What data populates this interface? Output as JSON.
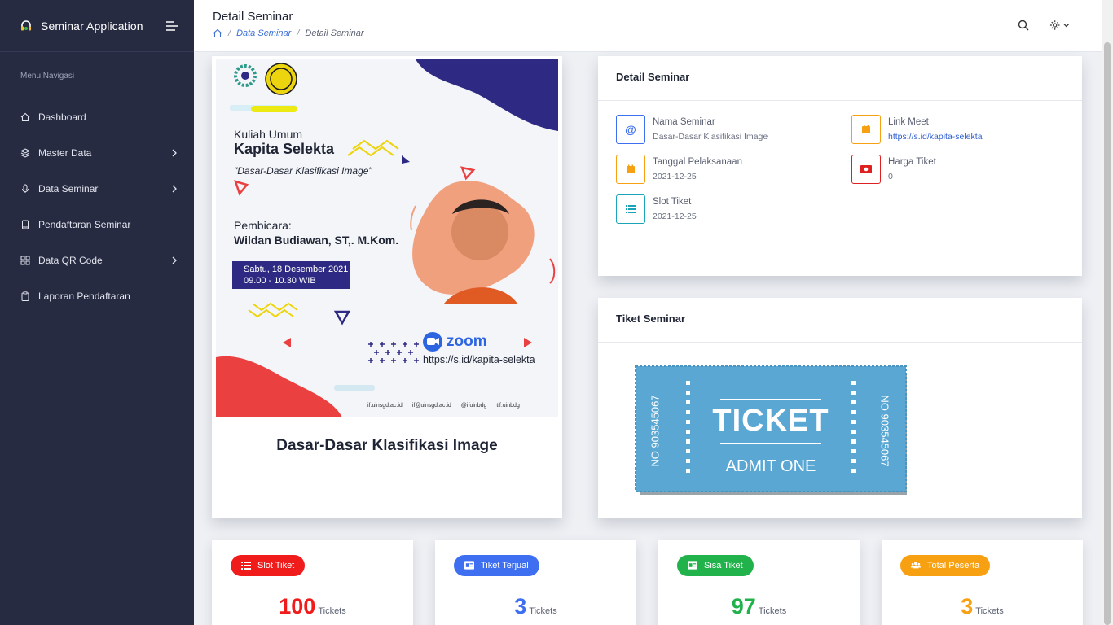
{
  "app": {
    "title": "Seminar Application"
  },
  "sidebar": {
    "heading": "Menu Navigasi",
    "items": [
      {
        "label": "Dashboard",
        "icon": "home-icon"
      },
      {
        "label": "Master Data",
        "icon": "layers-icon"
      },
      {
        "label": "Data Seminar",
        "icon": "microphone-icon"
      },
      {
        "label": "Pendaftaran Seminar",
        "icon": "book-icon"
      },
      {
        "label": "Data QR Code",
        "icon": "grid-icon"
      },
      {
        "label": "Laporan Pendaftaran",
        "icon": "clipboard-icon"
      }
    ]
  },
  "header": {
    "title": "Detail Seminar",
    "breadcrumb": {
      "link": "Data Seminar",
      "current": "Detail Seminar"
    }
  },
  "poster": {
    "subtitle": "Kuliah Umum",
    "title": "Kapita Selekta",
    "topic": "\"Dasar-Dasar Klasifikasi Image\"",
    "speaker_label": "Pembicara:",
    "speaker": "Wildan Budiawan, ST,. M.Kom.",
    "date": "Sabtu, 18 Desember 2021",
    "time": "09.00 - 10.30 WIB",
    "platform": "zoom",
    "url": "https://s.id/kapita-selekta",
    "footer": [
      "if.uinsgd.ac.id",
      "if@uinsgd.ac.id",
      "@ifuinbdg",
      "tif.uinbdg"
    ]
  },
  "seminar_name": "Dasar-Dasar Klasifikasi Image",
  "detail": {
    "title": "Detail Seminar",
    "nama_label": "Nama Seminar",
    "nama": "Dasar-Dasar Klasifikasi Image",
    "tanggal_label": "Tanggal Pelaksanaan",
    "tanggal": "2021-12-25",
    "slot_label": "Slot Tiket",
    "slot": "2021-12-25",
    "link_label": "Link Meet",
    "link": "https://s.id/kapita-selekta",
    "harga_label": "Harga Tiket",
    "harga": "0"
  },
  "ticket": {
    "title": "Tiket Seminar",
    "word": "TICKET",
    "admit": "ADMIT ONE",
    "number": "NO 903545067"
  },
  "stats": [
    {
      "label": "Slot Tiket",
      "value": "100",
      "unit": "Tickets",
      "color": "#f01c1c"
    },
    {
      "label": "Tiket Terjual",
      "value": "3",
      "unit": "Tickets",
      "color": "#3d6ff0"
    },
    {
      "label": "Sisa Tiket",
      "value": "97",
      "unit": "Tickets",
      "color": "#22b24c"
    },
    {
      "label": "Total Peserta",
      "value": "3",
      "unit": "Tickets",
      "color": "#f7a012"
    }
  ]
}
